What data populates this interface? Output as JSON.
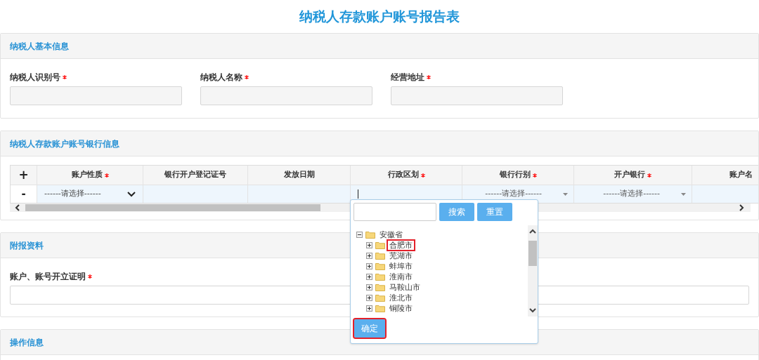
{
  "title": "纳税人存款账户账号报告表",
  "basic_info": {
    "heading": "纳税人基本信息",
    "fields": [
      {
        "label": "纳税人识别号",
        "required": true
      },
      {
        "label": "纳税人名称",
        "required": true
      },
      {
        "label": "经营地址",
        "required": true
      }
    ]
  },
  "bank_info": {
    "heading": "纳税人存款账户账号银行信息",
    "table": {
      "add_button": "+",
      "columns": [
        {
          "label": "账户性质",
          "required": true
        },
        {
          "label": "银行开户登记证号",
          "required": false
        },
        {
          "label": "发放日期",
          "required": false
        },
        {
          "label": "行政区划",
          "required": true
        },
        {
          "label": "银行行别",
          "required": true
        },
        {
          "label": "开户银行",
          "required": true
        },
        {
          "label": "账户名",
          "required": false
        }
      ],
      "rows": [
        {
          "remove_button": "-",
          "cells": [
            {
              "kind": "select",
              "value": "------请选择------"
            },
            {
              "kind": "text"
            },
            {
              "kind": "text"
            },
            {
              "kind": "input"
            },
            {
              "kind": "dropdown",
              "value": "------请选择------"
            },
            {
              "kind": "dropdown",
              "value": "------请选择------"
            },
            {
              "kind": "text"
            }
          ]
        }
      ]
    }
  },
  "region_picker": {
    "search_button": "搜索",
    "reset_button": "重置",
    "tree": [
      {
        "label": "安徽省",
        "expanded": true,
        "highlighted": false,
        "children": [
          {
            "label": "合肥市",
            "expanded": false,
            "highlighted": true
          },
          {
            "label": "芜湖市",
            "expanded": false,
            "highlighted": false
          },
          {
            "label": "蚌埠市",
            "expanded": false,
            "highlighted": false
          },
          {
            "label": "淮南市",
            "expanded": false,
            "highlighted": false
          },
          {
            "label": "马鞍山市",
            "expanded": false,
            "highlighted": false
          },
          {
            "label": "淮北市",
            "expanded": false,
            "highlighted": false
          },
          {
            "label": "铜陵市",
            "expanded": false,
            "highlighted": false
          }
        ]
      }
    ],
    "confirm_button": "确定",
    "confirm_highlighted": true
  },
  "attachments": {
    "heading": "附报资料",
    "fields": [
      {
        "label": "账户、账号开立证明",
        "required": true
      }
    ]
  },
  "operation_info": {
    "heading": "操作信息"
  }
}
